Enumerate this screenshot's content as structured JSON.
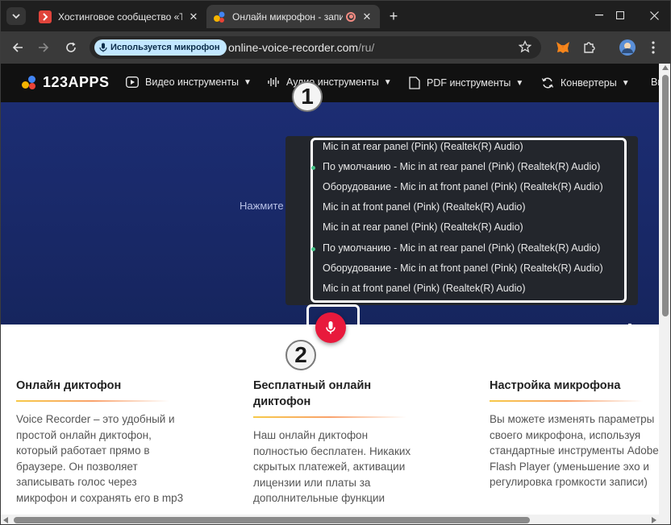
{
  "browser": {
    "tabs": [
      {
        "title": "Хостинговое сообщество «Tim",
        "active": false
      },
      {
        "title": "Онлайн микрофон - запис",
        "active": true
      }
    ],
    "omnibox": {
      "mic_chip": "Используется микрофон",
      "url_host": "online-voice-recorder.com",
      "url_path": "/ru/"
    }
  },
  "site": {
    "logo": "123APPS",
    "nav": [
      {
        "label": "Видео инструменты",
        "icon": "play-icon"
      },
      {
        "label": "Аудио инструменты",
        "icon": "waveform-icon"
      },
      {
        "label": "PDF инструменты",
        "icon": "document-icon"
      },
      {
        "label": "Конвертеры",
        "icon": "convert-icon"
      },
      {
        "label": "Вы"
      }
    ],
    "hero_hint": "Нажмите",
    "mic_options": [
      {
        "label": "Mic in at rear panel (Pink) (Realtek(R) Audio)",
        "default": false
      },
      {
        "label": "По умолчанию - Mic in at rear panel (Pink) (Realtek(R) Audio)",
        "default": true
      },
      {
        "label": "Оборудование - Mic in at front panel (Pink) (Realtek(R) Audio)",
        "default": false
      },
      {
        "label": "Mic in at front panel (Pink) (Realtek(R) Audio)",
        "default": false
      },
      {
        "label": "Mic in at rear panel (Pink) (Realtek(R) Audio)",
        "default": false
      },
      {
        "label": "По умолчанию - Mic in at rear panel (Pink) (Realtek(R) Audio)",
        "default": true
      },
      {
        "label": "Оборудование - Mic in at front panel (Pink) (Realtek(R) Audio)",
        "default": false
      },
      {
        "label": "Mic in at front panel (Pink) (Realtek(R) Audio)",
        "default": false
      }
    ],
    "badges": [
      "1",
      "2"
    ],
    "columns": [
      {
        "title": "Онлайн диктофон",
        "text": "Voice Recorder – это удобный и простой онлайн диктофон, который работает прямо в браузере. Он позволяет записывать голос через микрофон и сохранять его в mp3"
      },
      {
        "title": "Бесплатный онлайн диктофон",
        "text": "Наш онлайн диктофон полностью бесплатен. Никаких скрытых платежей, активации лицензии или платы за дополнительные функции"
      },
      {
        "title": "Настройка микрофона",
        "text": "Вы можете изменять параметры своего микрофона, используя стандартные инструменты Adobe Flash Player (уменьшение эхо и регулировка громкости записи)"
      }
    ]
  },
  "colors": {
    "hero": "#1c2d73",
    "record_button": "#e8193c",
    "default_dot": "#47c58a",
    "mic_chip": "#c2e7ff"
  }
}
